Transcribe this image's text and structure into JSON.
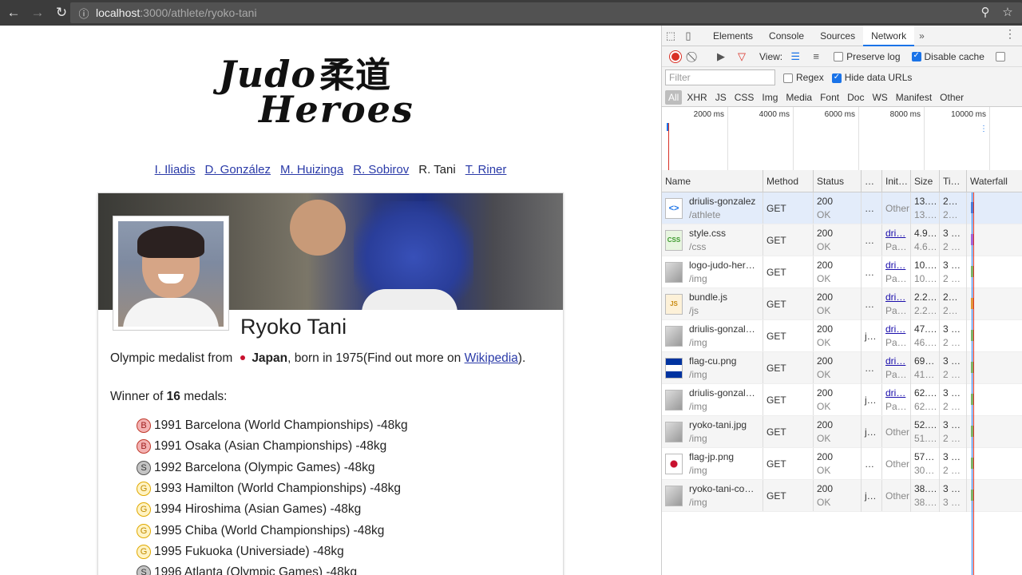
{
  "browser": {
    "url_host": "localhost",
    "url_path": ":3000/athlete/ryoko-tani"
  },
  "logo": {
    "line1": "Judo",
    "kanji": "柔道",
    "line2": "Heroes"
  },
  "athlete_nav": [
    {
      "label": "I. Iliadis",
      "current": false
    },
    {
      "label": "D. González",
      "current": false
    },
    {
      "label": "M. Huizinga",
      "current": false
    },
    {
      "label": "R. Sobirov",
      "current": false
    },
    {
      "label": "R. Tani",
      "current": true
    },
    {
      "label": "T. Riner",
      "current": false
    }
  ],
  "athlete": {
    "name": "Ryoko Tani",
    "bio_prefix": "Olympic medalist from",
    "country": "Japan",
    "bio_born": ", born in 1975(Find out more on",
    "wiki_link": "Wikipedia",
    "bio_suffix": ").",
    "winner_prefix": "Winner of",
    "medal_count": "16",
    "winner_suffix": "medals:",
    "medals": [
      {
        "type": "B",
        "text": "1991 Barcelona (World Championships) -48kg"
      },
      {
        "type": "B",
        "text": "1991 Osaka (Asian Championships) -48kg"
      },
      {
        "type": "S",
        "text": "1992 Barcelona (Olympic Games) -48kg"
      },
      {
        "type": "G",
        "text": "1993 Hamilton (World Championships) -48kg"
      },
      {
        "type": "G",
        "text": "1994 Hiroshima (Asian Games) -48kg"
      },
      {
        "type": "G",
        "text": "1995 Chiba (World Championships) -48kg"
      },
      {
        "type": "G",
        "text": "1995 Fukuoka (Universiade) -48kg"
      },
      {
        "type": "S",
        "text": "1996 Atlanta (Olympic Games) -48kg"
      }
    ]
  },
  "devtools": {
    "tabs": [
      "Elements",
      "Console",
      "Sources",
      "Network"
    ],
    "active_tab": "Network",
    "more": "»",
    "view_label": "View:",
    "preserve_log": "Preserve log",
    "disable_cache": "Disable cache",
    "filter_placeholder": "Filter",
    "regex": "Regex",
    "hide_data_urls": "Hide data URLs",
    "types": [
      "All",
      "XHR",
      "JS",
      "CSS",
      "Img",
      "Media",
      "Font",
      "Doc",
      "WS",
      "Manifest",
      "Other"
    ],
    "timeline_ticks": [
      "2000 ms",
      "4000 ms",
      "6000 ms",
      "8000 ms",
      "10000 ms"
    ],
    "columns": [
      "Name",
      "Method",
      "Status",
      "…",
      "Init…",
      "Size",
      "Ti…",
      "Waterfall"
    ],
    "requests": [
      {
        "name": "driulis-gonzalez",
        "path": "/athlete",
        "method": "GET",
        "status": "200",
        "status_text": "OK",
        "dots": "…",
        "init": "Other",
        "init_link": false,
        "init_sub": "",
        "size": "13.…",
        "size_sub": "13.…",
        "time": "2…",
        "time_sub": "2…",
        "icon": "html",
        "icon_label": "<>",
        "wf_color": "#4a7bd8"
      },
      {
        "name": "style.css",
        "path": "/css",
        "method": "GET",
        "status": "200",
        "status_text": "OK",
        "dots": "…",
        "init": "dri…",
        "init_link": true,
        "init_sub": "Pa…",
        "size": "4.9…",
        "size_sub": "4.6…",
        "time": "3 …",
        "time_sub": "2 …",
        "icon": "css",
        "icon_label": "CSS",
        "wf_color": "#a066d8"
      },
      {
        "name": "logo-judo-her…",
        "path": "/img",
        "method": "GET",
        "status": "200",
        "status_text": "OK",
        "dots": "…",
        "init": "dri…",
        "init_link": true,
        "init_sub": "Pa…",
        "size": "10.…",
        "size_sub": "10.…",
        "time": "3 …",
        "time_sub": "2 …",
        "icon": "img",
        "icon_label": "",
        "wf_color": "#7cb36a"
      },
      {
        "name": "bundle.js",
        "path": "/js",
        "method": "GET",
        "status": "200",
        "status_text": "OK",
        "dots": "…",
        "init": "dri…",
        "init_link": true,
        "init_sub": "Pa…",
        "size": "2.2…",
        "size_sub": "2.2…",
        "time": "2…",
        "time_sub": "2…",
        "icon": "js",
        "icon_label": "JS",
        "wf_color": "#e0963a"
      },
      {
        "name": "driulis-gonzal…",
        "path": "/img",
        "method": "GET",
        "status": "200",
        "status_text": "OK",
        "dots": "j…",
        "init": "dri…",
        "init_link": true,
        "init_sub": "Pa…",
        "size": "47.…",
        "size_sub": "46.…",
        "time": "3 …",
        "time_sub": "2 …",
        "icon": "img",
        "icon_label": "",
        "wf_color": "#7cb36a"
      },
      {
        "name": "flag-cu.png",
        "path": "/img",
        "method": "GET",
        "status": "200",
        "status_text": "OK",
        "dots": "…",
        "init": "dri…",
        "init_link": true,
        "init_sub": "Pa…",
        "size": "69…",
        "size_sub": "41…",
        "time": "3 …",
        "time_sub": "2 …",
        "icon": "flagcu",
        "icon_label": "",
        "wf_color": "#7cb36a"
      },
      {
        "name": "driulis-gonzal…",
        "path": "/img",
        "method": "GET",
        "status": "200",
        "status_text": "OK",
        "dots": "j…",
        "init": "dri…",
        "init_link": true,
        "init_sub": "Pa…",
        "size": "62.…",
        "size_sub": "62.…",
        "time": "3 …",
        "time_sub": "2 …",
        "icon": "img",
        "icon_label": "",
        "wf_color": "#7cb36a"
      },
      {
        "name": "ryoko-tani.jpg",
        "path": "/img",
        "method": "GET",
        "status": "200",
        "status_text": "OK",
        "dots": "j…",
        "init": "Other",
        "init_link": false,
        "init_sub": "",
        "size": "52.…",
        "size_sub": "51.…",
        "time": "3 …",
        "time_sub": "2 …",
        "icon": "img",
        "icon_label": "",
        "wf_color": "#7cb36a"
      },
      {
        "name": "flag-jp.png",
        "path": "/img",
        "method": "GET",
        "status": "200",
        "status_text": "OK",
        "dots": "…",
        "init": "Other",
        "init_link": false,
        "init_sub": "",
        "size": "57…",
        "size_sub": "30…",
        "time": "3 …",
        "time_sub": "2 …",
        "icon": "flagjp",
        "icon_label": "",
        "wf_color": "#7cb36a"
      },
      {
        "name": "ryoko-tani-co…",
        "path": "/img",
        "method": "GET",
        "status": "200",
        "status_text": "OK",
        "dots": "j…",
        "init": "Other",
        "init_link": false,
        "init_sub": "",
        "size": "38.…",
        "size_sub": "38.…",
        "time": "3 …",
        "time_sub": "3 …",
        "icon": "img",
        "icon_label": "",
        "wf_color": "#7cb36a"
      }
    ]
  }
}
